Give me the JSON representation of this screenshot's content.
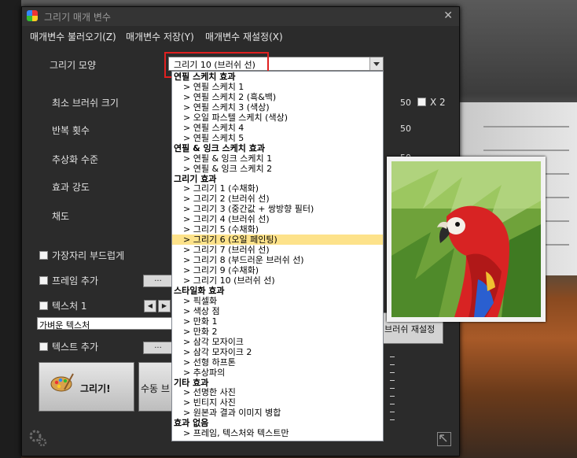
{
  "window": {
    "title": "그리기 매개 변수"
  },
  "menu": [
    "매개변수 불러오기(Z)",
    "매개변수 저장(Y)",
    "매개변수 재설정(X)"
  ],
  "params": {
    "style_label": "그리기 모양",
    "style_value": "그리기 10 (브러쉬 선)",
    "brush_size_label": "최소 브러쉬 크기",
    "brush_size_value": "50",
    "x2_label": "X 2",
    "repeat_label": "반복 횟수",
    "repeat_value": "50",
    "abstraction_label": "추상화 수준",
    "abstraction_value": "50",
    "intensity_label": "효과 강도",
    "saturation_label": "채도"
  },
  "options": {
    "smooth_edges_label": "가장자리 부드럽게",
    "add_frame_label": "프레임 추가",
    "browse_label": "...",
    "texture_label": "텍스처 1",
    "texture_value": "가벼운 텍스처",
    "add_text_label": "텍스트 추가",
    "prev_icon": "◀",
    "next_icon": "▶"
  },
  "buttons": {
    "paint": "그리기!",
    "manual": "수동 브",
    "brush_reset": "브러쉬 재설정"
  },
  "dropdown": [
    {
      "type": "group",
      "text": "연필 스케치 효과"
    },
    {
      "type": "item",
      "text": ">  연필 스케치 1"
    },
    {
      "type": "item",
      "text": ">  연필 스케치 2 (흑&백)"
    },
    {
      "type": "item",
      "text": ">  연필 스케치 3 (색상)"
    },
    {
      "type": "item",
      "text": ">  오일 파스텔 스케치 (색상)"
    },
    {
      "type": "item",
      "text": ">  연필 스케치 4"
    },
    {
      "type": "item",
      "text": ">  연필 스케치 5"
    },
    {
      "type": "group",
      "text": "연필 & 잉크 스케치 효과"
    },
    {
      "type": "item",
      "text": ">  연필 & 잉크 스케치 1"
    },
    {
      "type": "item",
      "text": ">  연필 & 잉크 스케치 2"
    },
    {
      "type": "group",
      "text": "그리기 효과"
    },
    {
      "type": "item",
      "text": ">  그리기 1 (수채화)"
    },
    {
      "type": "item",
      "text": ">  그리기 2 (브러쉬 선)"
    },
    {
      "type": "item",
      "text": ">  그리기 3 (중간값 + 쌍방향 필터)"
    },
    {
      "type": "item",
      "text": ">  그리기 4 (브러쉬 선)"
    },
    {
      "type": "item",
      "text": ">  그리기 5 (수채화)"
    },
    {
      "type": "item",
      "text": ">  그리기 6 (오일 페인팅)",
      "selected": true
    },
    {
      "type": "item",
      "text": ">  그리기 7 (브러쉬 선)"
    },
    {
      "type": "item",
      "text": ">  그리기 8 (부드러운 브러쉬 선)"
    },
    {
      "type": "item",
      "text": ">  그리기 9 (수채화)"
    },
    {
      "type": "item",
      "text": ">  그리기 10 (브러쉬 선)"
    },
    {
      "type": "group",
      "text": "스타일화 효과"
    },
    {
      "type": "item",
      "text": ">  픽셀화"
    },
    {
      "type": "item",
      "text": ">  색상 점"
    },
    {
      "type": "item",
      "text": ">  만화 1"
    },
    {
      "type": "item",
      "text": ">  만화 2"
    },
    {
      "type": "item",
      "text": ">  삼각 모자이크"
    },
    {
      "type": "item",
      "text": ">  삼각 모자이크 2"
    },
    {
      "type": "item",
      "text": ">  선형 하프톤"
    },
    {
      "type": "item",
      "text": ">  추상파의"
    },
    {
      "type": "group",
      "text": "기타 효과"
    },
    {
      "type": "item",
      "text": ">  선명한 사진"
    },
    {
      "type": "item",
      "text": ">  빈티지 사진"
    },
    {
      "type": "item",
      "text": ">  원본과 결과 이미지 병합"
    },
    {
      "type": "group",
      "text": "효과 없음"
    },
    {
      "type": "item",
      "text": ">  프레임, 텍스처와 텍스트만"
    }
  ],
  "colors": {
    "highlight": "#fde28a",
    "callout": "#e02020"
  }
}
